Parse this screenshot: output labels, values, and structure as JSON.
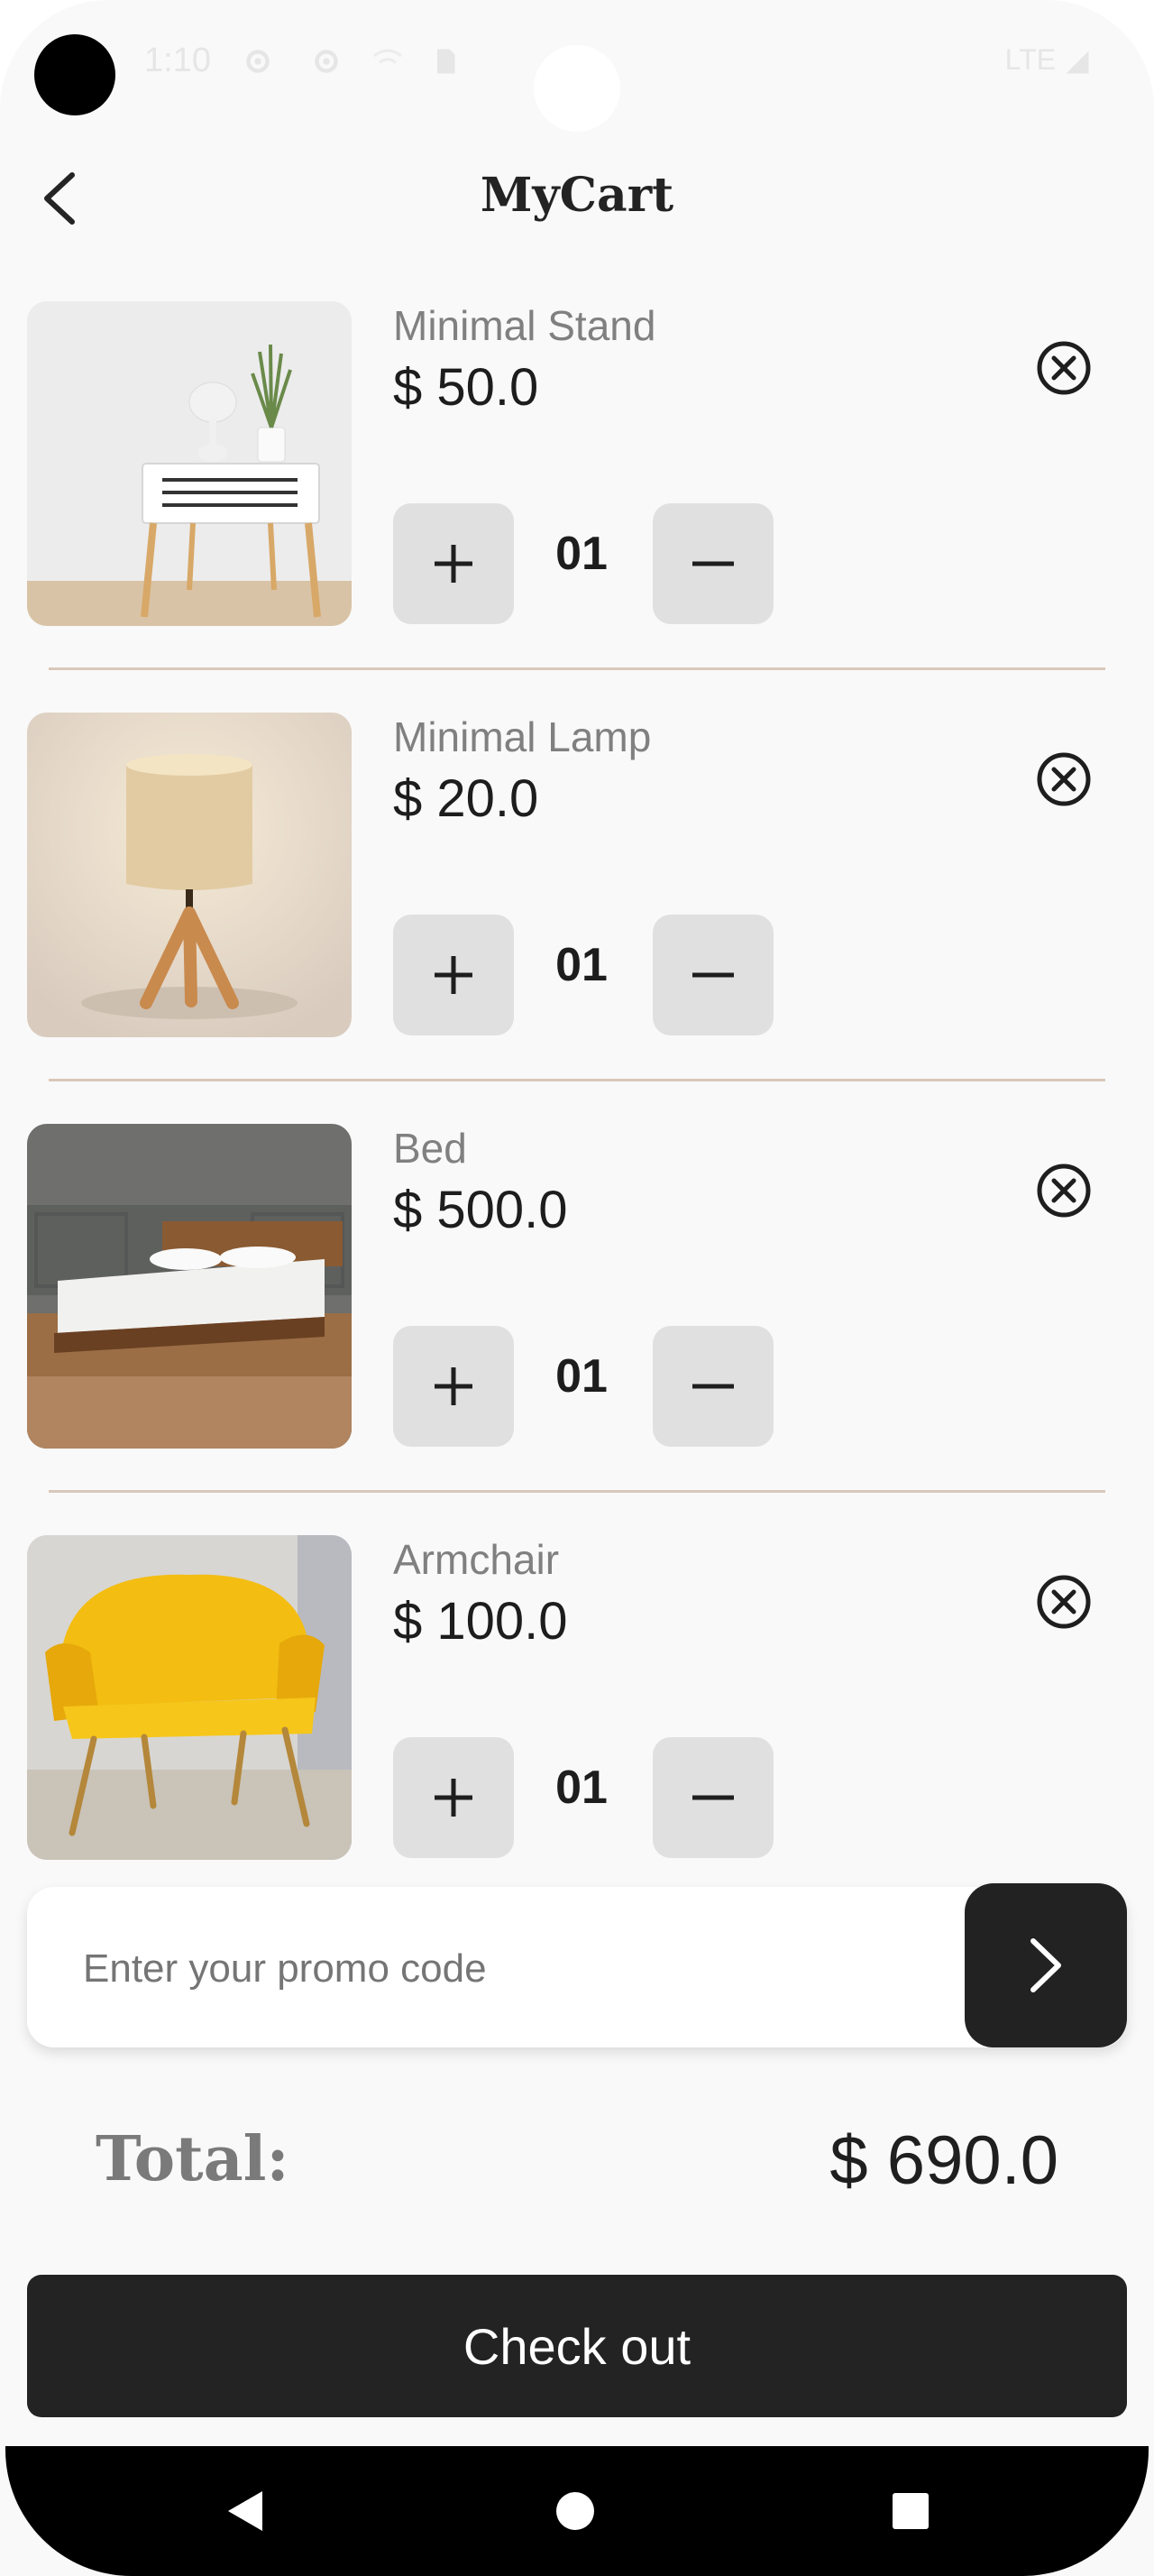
{
  "status_bar": {
    "time": "1:10",
    "network": "LTE",
    "icons": [
      "gear-icon",
      "gear-icon",
      "wifi-off-icon",
      "sim-card-icon",
      "signal-icon",
      "battery-icon"
    ]
  },
  "header": {
    "title": "MyCart",
    "back_icon": "chevron-left-icon"
  },
  "cart": {
    "items": [
      {
        "name": "Minimal Stand",
        "price": "$ 50.0",
        "quantity": "01",
        "image": "white bedside stand with plant and lamp"
      },
      {
        "name": "Minimal Lamp",
        "price": "$ 20.0",
        "quantity": "01",
        "image": "tripod table lamp with linen shade"
      },
      {
        "name": "Bed",
        "price": "$ 500.0",
        "quantity": "01",
        "image": "wooden platform bed with white mattress"
      },
      {
        "name": "Armchair",
        "price": "$ 100.0",
        "quantity": "01",
        "image": "yellow velvet armchair"
      }
    ],
    "remove_icon": "close-circle-icon",
    "plus_icon": "plus-icon",
    "minus_icon": "minus-icon"
  },
  "promo": {
    "placeholder": "Enter your promo code",
    "value": "",
    "submit_icon": "chevron-right-icon"
  },
  "total": {
    "label": "Total:",
    "value": "$ 690.0"
  },
  "checkout": {
    "label": "Check out"
  },
  "nav_bar": {
    "icons": [
      "back-triangle-icon",
      "home-circle-icon",
      "recents-square-icon"
    ]
  },
  "colors": {
    "background": "#f9f9f9",
    "primary_dark": "#232323",
    "qty_button": "#e0e0e0",
    "divider": "#d8c8bb",
    "muted_text": "#808080"
  }
}
